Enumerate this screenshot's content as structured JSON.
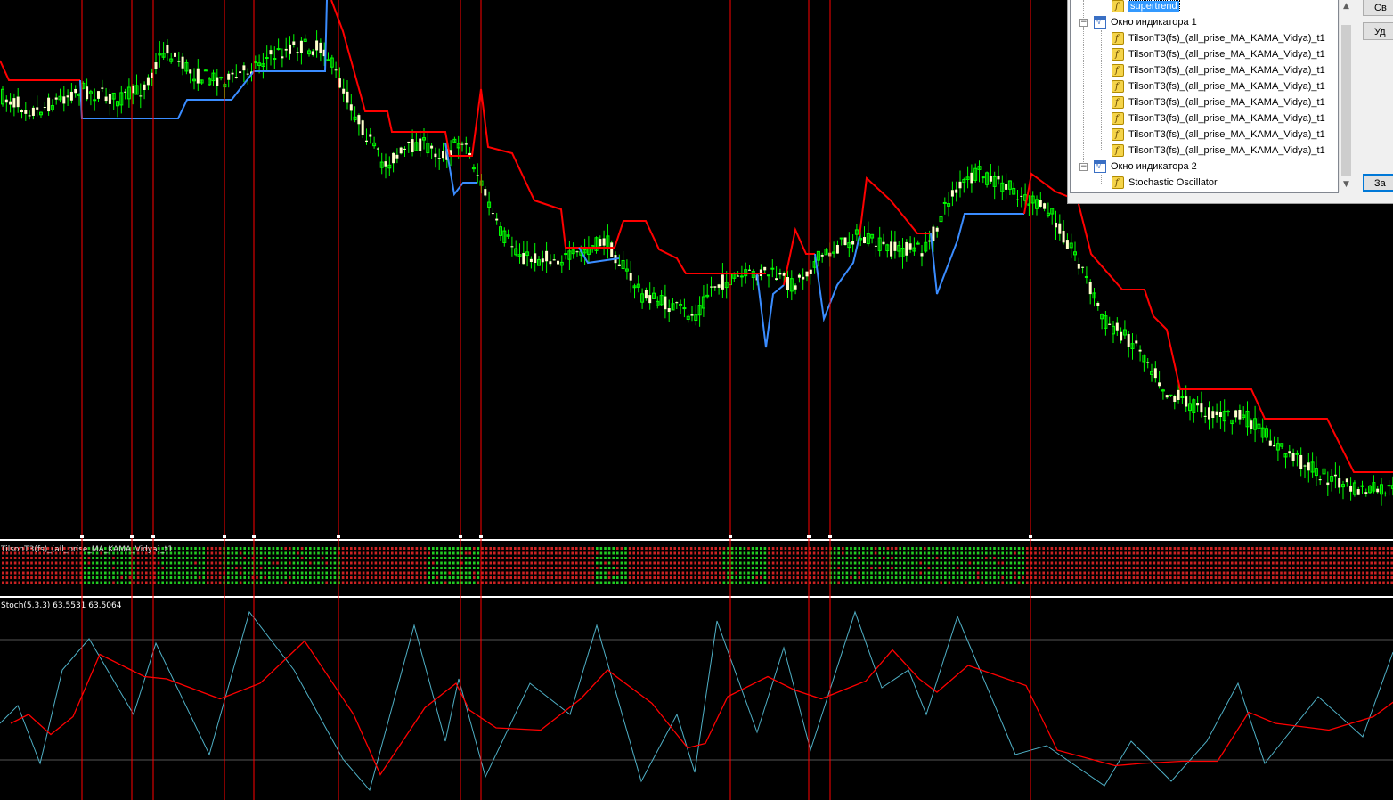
{
  "chart": {
    "colors": {
      "bull_candle": "#ffffcc",
      "bear_candle": "#00ff00",
      "supertrend_up": "#ff0000",
      "supertrend_down": "#3a8cff",
      "vline": "#ff0000",
      "tilson_up": "#22cc22",
      "tilson_down": "#cc2222",
      "stoch_main": "#4fb0c6",
      "stoch_signal": "#ff0000"
    }
  },
  "panels": {
    "tilson_label": "TilsonT3(fs)_(all_prise_MA_KAMA_Vidya)_t1",
    "stoch_label": "Stoch(5,3,3) 63.5531 63.5064"
  },
  "dialog": {
    "tree": {
      "selected_item": "supertrend",
      "window1_title": "Окно индикатора 1",
      "window1_items": [
        "TilsonT3(fs)_(all_prise_MA_KAMA_Vidya)_t1",
        "TilsonT3(fs)_(all_prise_MA_KAMA_Vidya)_t1",
        "TilsonT3(fs)_(all_prise_MA_KAMA_Vidya)_t1",
        "TilsonT3(fs)_(all_prise_MA_KAMA_Vidya)_t1",
        "TilsonT3(fs)_(all_prise_MA_KAMA_Vidya)_t1",
        "TilsonT3(fs)_(all_prise_MA_KAMA_Vidya)_t1",
        "TilsonT3(fs)_(all_prise_MA_KAMA_Vidya)_t1",
        "TilsonT3(fs)_(all_prise_MA_KAMA_Vidya)_t1"
      ],
      "window2_title": "Окно индикатора 2",
      "window2_items": [
        "Stochastic Oscillator"
      ]
    },
    "buttons": {
      "properties": "Св",
      "delete": "Уд",
      "close": "За"
    }
  }
}
